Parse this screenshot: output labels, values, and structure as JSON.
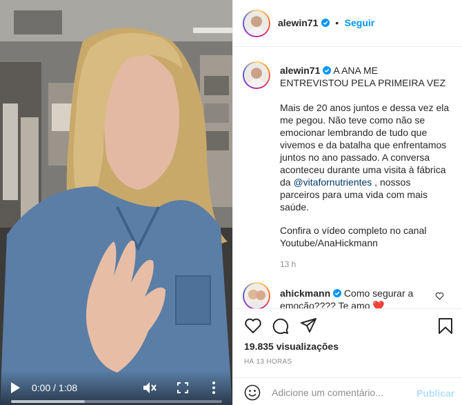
{
  "video": {
    "time_display": "0:00 / 1:08",
    "progress_fraction": 0.0,
    "buffered_fraction": 0.35
  },
  "post": {
    "author": "alewin71",
    "follow_label": "Seguir",
    "separator": "•",
    "caption_title": "A ANA ME ENTREVISTOU PELA PRIMEIRA VEZ",
    "caption_body_before": "Mais de 20 anos juntos e dessa vez ela me pegou. Não teve como não se emocionar lembrando de tudo que vivemos e da batalha que enfrentamos juntos no ano passado. A conversa aconteceu durante uma visita à fábrica da ",
    "caption_mention": "@vitafornutrientes",
    "caption_body_after": " , nossos parceiros para uma vida com mais saúde.",
    "caption_cta": "Confira o vídeo completo no canal Youtube/AnaHickmann",
    "caption_age": "13 h",
    "verified_color": "#0095f6"
  },
  "comment": {
    "author": "ahickmann",
    "text": "Como segurar a emoção???? Te amo ❤️"
  },
  "actions": {
    "views": "19.835 visualizações",
    "posted": "HÁ 13 HORAS"
  },
  "add_comment": {
    "placeholder": "Adicione um comentário...",
    "publish_label": "Publicar"
  },
  "icons": [
    "play-icon",
    "mute-icon",
    "fullscreen-icon",
    "more-icon",
    "verified-icon",
    "heart-icon",
    "comment-icon",
    "share-icon",
    "bookmark-icon",
    "emoji-icon"
  ]
}
